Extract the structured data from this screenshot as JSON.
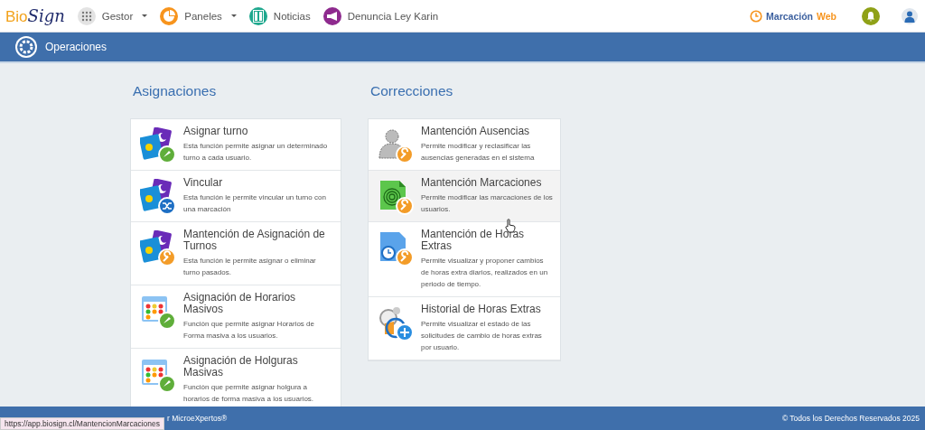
{
  "nav": {
    "logo": {
      "part1": "Bio",
      "part2": "Sign"
    },
    "items": [
      {
        "label": "Gestor",
        "kind": "grid",
        "dropdown": true
      },
      {
        "label": "Paneles",
        "kind": "chart",
        "dropdown": true
      },
      {
        "label": "Noticias",
        "kind": "news",
        "dropdown": false
      },
      {
        "label": "Denuncia Ley Karin",
        "kind": "megaphone",
        "dropdown": false
      }
    ],
    "clock_link": {
      "label": "Marcación",
      "accent": "Web"
    }
  },
  "section_bar": {
    "title": "Operaciones"
  },
  "columns": [
    {
      "heading": "Asignaciones",
      "cards": [
        {
          "title": "Asignar turno",
          "description": "Esta función permite asignar un determinado turno a cada usuario.",
          "kind": "shift-check",
          "hovered": false
        },
        {
          "title": "Vincular",
          "description": "Esta función le permite vincular un turno con una marcación",
          "kind": "shift-shuffle",
          "hovered": false
        },
        {
          "title": "Mantención de Asignación de Turnos",
          "description": "Esta función le permite asignar o eliminar turno pasados.",
          "kind": "shift-wrench",
          "hovered": false
        },
        {
          "title": "Asignación de Horarios Masivos",
          "description": "Función que permite asignar Horarios de Forma masiva a los usuarios.",
          "kind": "calendar-check",
          "hovered": false
        },
        {
          "title": "Asignación de Holguras Masivas",
          "description": "Función que permite asignar holgura a horarios de forma masiva a los usuarios.",
          "kind": "calendar-check",
          "hovered": false
        }
      ]
    },
    {
      "heading": "Correcciones",
      "cards": [
        {
          "title": "Mantención Ausencias",
          "description": "Permite modificar y reclasificar las ausencias generadas en el sistema",
          "kind": "person-wrench",
          "hovered": false
        },
        {
          "title": "Mantención Marcaciones",
          "description": "Permite modificar las marcaciones de los usuarios.",
          "kind": "fingerprint-wrench",
          "hovered": true
        },
        {
          "title": "Mantención de Horas Extras",
          "description": "Permite visualizar y proponer cambios de horas extra diarios, realizados en un periodo de tiempo.",
          "kind": "docclock-wrench",
          "hovered": false
        },
        {
          "title": "Historial de Horas Extras",
          "description": "Permite visualizar el estado de las solicitudes de cambio de horas extras por usuario.",
          "kind": "clocks-plus",
          "hovered": false
        }
      ]
    }
  ],
  "footer": {
    "left": "r MicroeXpertos®",
    "right": "© Todos los Derechos Reservados 2025"
  },
  "status_url": "https://app.biosign.cl/MantencionMarcaciones"
}
